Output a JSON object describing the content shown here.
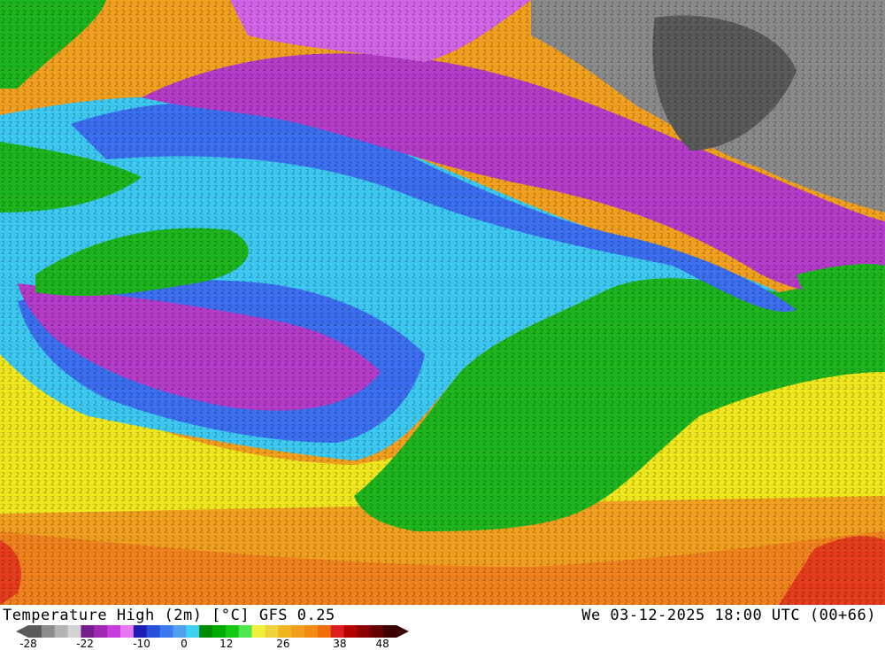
{
  "map": {
    "regions": [
      {
        "name": "polar-far-north",
        "color": "#8a8a8a"
      },
      {
        "name": "very-cold",
        "color": "#b43cc8"
      },
      {
        "name": "cold",
        "color": "#3c6ef0"
      },
      {
        "name": "cool",
        "color": "#3cc8f0"
      },
      {
        "name": "mild",
        "color": "#1eb41e"
      },
      {
        "name": "warm",
        "color": "#f0e61e"
      },
      {
        "name": "hot",
        "color": "#f0a01e"
      },
      {
        "name": "very-hot",
        "color": "#e63c1e"
      }
    ]
  },
  "footer": {
    "title": "Temperature High (2m) [°C] GFS 0.25",
    "valid_time": "We 03-12-2025 18:00 UTC (00+66)"
  },
  "legend": {
    "tick_labels": [
      "-28",
      "-22",
      "-10",
      "0",
      "12",
      "26",
      "38",
      "48"
    ],
    "colors": [
      "#5a5a5a",
      "#8c8c8c",
      "#b4b4b4",
      "#d2d2d2",
      "#781e8c",
      "#a028b4",
      "#c83cdc",
      "#e678f0",
      "#1e1eb4",
      "#2850dc",
      "#3c78f0",
      "#50a0f0",
      "#3cd2f0",
      "#008c00",
      "#00aa00",
      "#14c814",
      "#50e650",
      "#f0f03c",
      "#f0d23c",
      "#f0b41e",
      "#f0a01e",
      "#f08c14",
      "#f06e0a",
      "#dc1e1e",
      "#b40000",
      "#8c0000",
      "#640000",
      "#3c0000"
    ],
    "tick_positions": [
      0,
      0.154,
      0.308,
      0.423,
      0.538,
      0.692,
      0.846,
      0.962
    ]
  }
}
